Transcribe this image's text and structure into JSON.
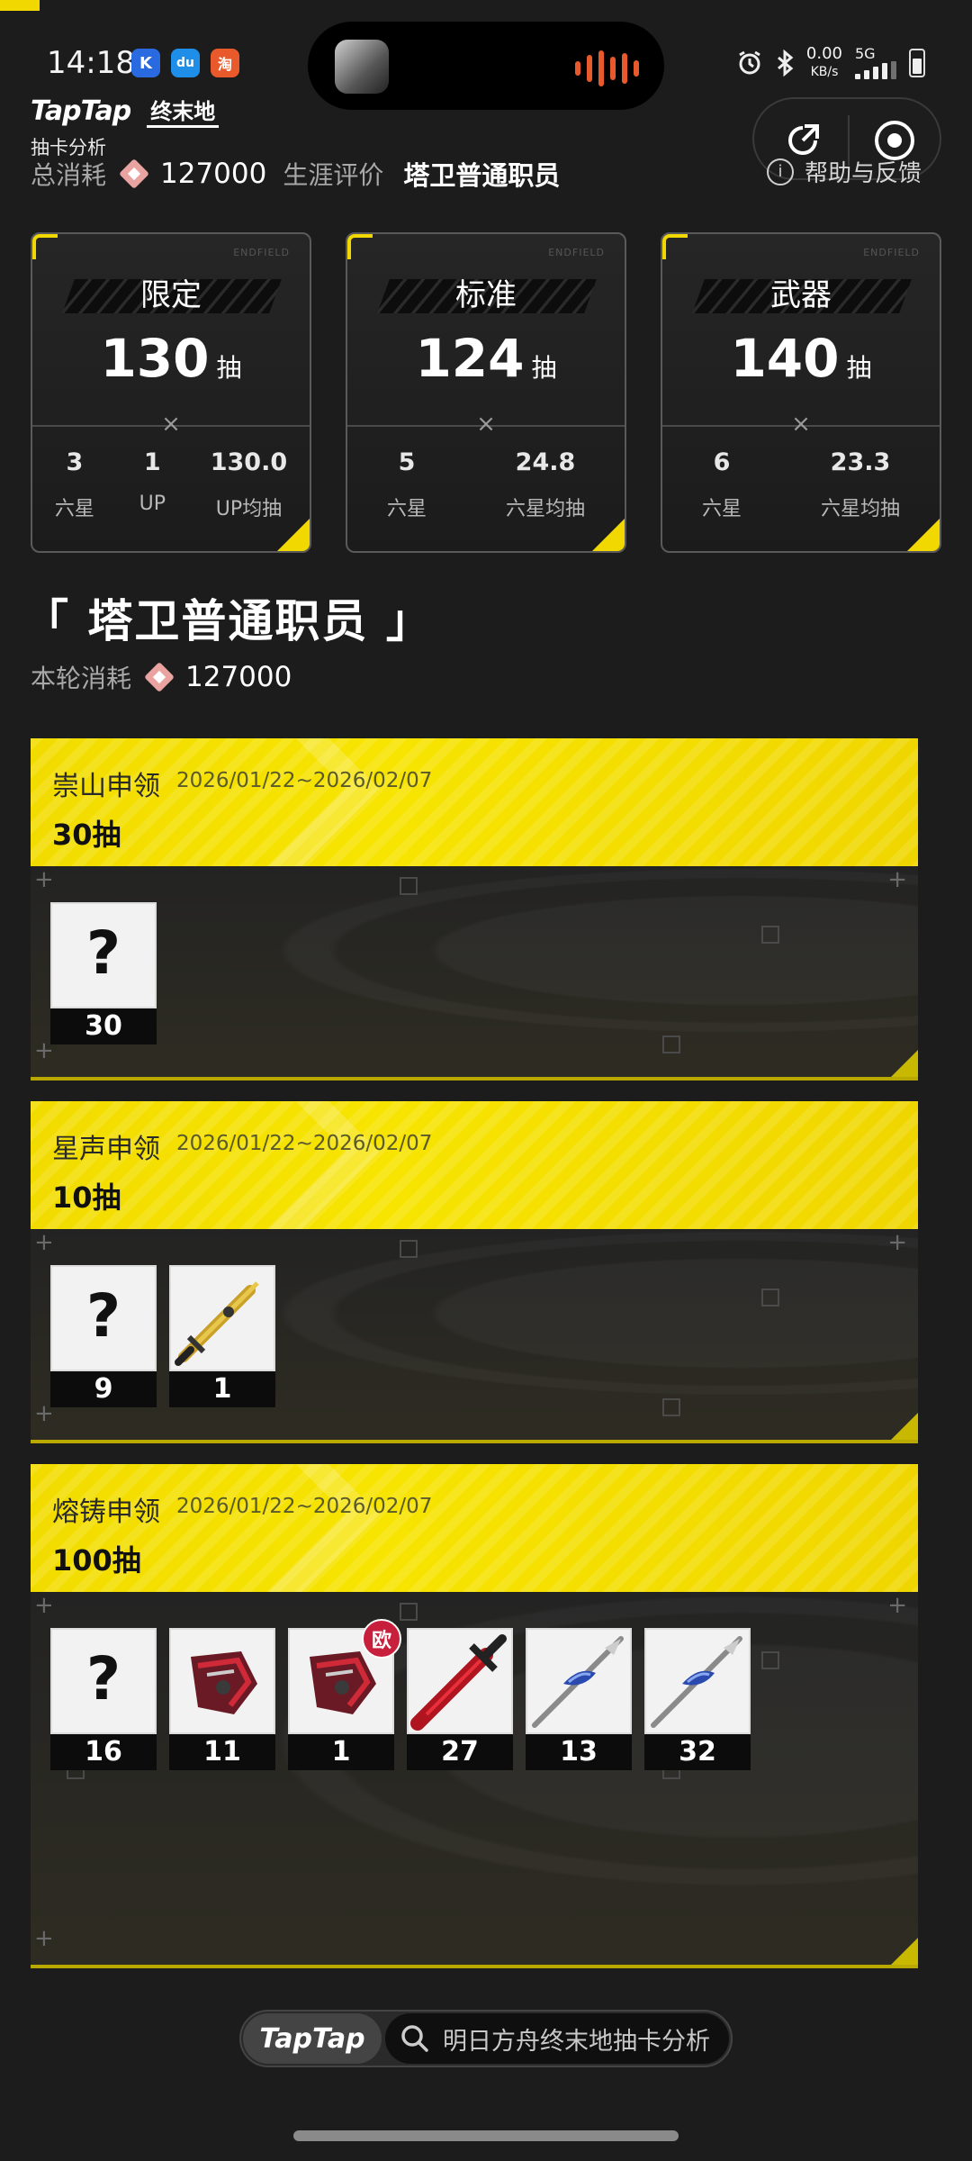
{
  "status_bar": {
    "time": "14:18",
    "net_speed": "0.00",
    "net_unit": "KB/s",
    "network_type": "5G",
    "apps": [
      {
        "icon": "k-app-icon",
        "label": "K",
        "color": "#2a6ae0"
      },
      {
        "icon": "du-app-icon",
        "label": "du",
        "color": "#1e8ee8"
      },
      {
        "icon": "shop-app-icon",
        "label": "淘",
        "color": "#e85a2c"
      }
    ]
  },
  "header": {
    "brand": "TapTap",
    "game_logo": "终末地",
    "app_name": "抽卡分析",
    "total_cost_label": "总消耗",
    "total_cost": "127000",
    "rating_label": "生涯评价",
    "rating_value": "塔卫普通职员",
    "help_label": "帮助与反馈"
  },
  "summary_cards": [
    {
      "title": "限定",
      "pulls": "130",
      "unit": "抽",
      "stats": [
        {
          "value": "3",
          "label": "六星"
        },
        {
          "value": "1",
          "label": "UP"
        },
        {
          "value": "130.0",
          "label": "UP均抽"
        }
      ]
    },
    {
      "title": "标准",
      "pulls": "124",
      "unit": "抽",
      "stats": [
        {
          "value": "5",
          "label": "六星"
        },
        {
          "value": "24.8",
          "label": "六星均抽"
        }
      ]
    },
    {
      "title": "武器",
      "pulls": "140",
      "unit": "抽",
      "stats": [
        {
          "value": "6",
          "label": "六星"
        },
        {
          "value": "23.3",
          "label": "六星均抽"
        }
      ]
    }
  ],
  "card_brand": "ENDFIELD",
  "card_x": "×",
  "section": {
    "title": "「 塔卫普通职员 」",
    "round_cost_label": "本轮消耗",
    "round_cost": "127000"
  },
  "banners": [
    {
      "name": "崇山申领",
      "dates": "2026/01/22~2026/02/07",
      "count": "30抽",
      "items": [
        {
          "type": "unknown",
          "glyph": "?",
          "count": "30"
        }
      ]
    },
    {
      "name": "星声申领",
      "dates": "2026/01/22~2026/02/07",
      "count": "10抽",
      "items": [
        {
          "type": "unknown",
          "glyph": "?",
          "count": "9"
        },
        {
          "type": "weapon-gold-sword",
          "count": "1"
        }
      ]
    },
    {
      "name": "熔铸申领",
      "dates": "2026/01/22~2026/02/07",
      "count": "100抽",
      "items": [
        {
          "type": "unknown",
          "glyph": "?",
          "count": "16"
        },
        {
          "type": "weapon-red-gauntlet",
          "count": "11"
        },
        {
          "type": "weapon-red-gauntlet",
          "count": "1",
          "badge": "欧"
        },
        {
          "type": "weapon-red-blade",
          "count": "27"
        },
        {
          "type": "weapon-blue-spear",
          "count": "13"
        },
        {
          "type": "weapon-blue-spear",
          "count": "32"
        }
      ]
    }
  ],
  "bottom_bar": {
    "brand": "TapTap",
    "search_text": "明日方舟终末地抽卡分析"
  },
  "colors": {
    "accent": "#f0d800",
    "background": "#1c1c1c",
    "badge": "#c8203c"
  }
}
